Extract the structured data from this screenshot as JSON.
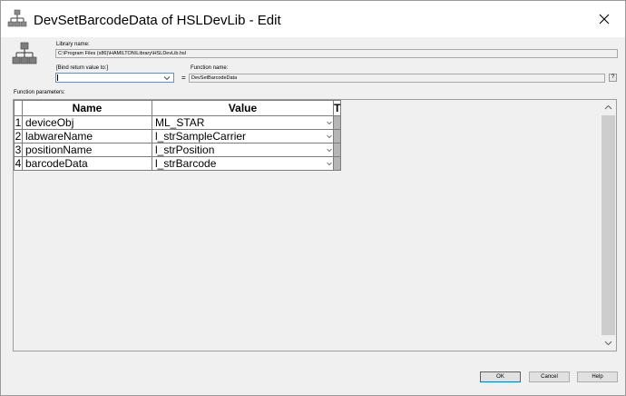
{
  "window": {
    "title": "DevSetBarcodeData of HSLDevLib - Edit"
  },
  "library": {
    "label": "Library name:",
    "value": "C:\\Program Files (x86)\\HAMILTON\\Library\\HSLDevLib.hsl"
  },
  "bind": {
    "label": "[Bind return value to:]",
    "value": ""
  },
  "equals": "=",
  "function": {
    "label": "Function name:",
    "value": "DevSetBarcodeData",
    "help_label": "?"
  },
  "params": {
    "label": "Function parameters:",
    "headers": {
      "name": "Name",
      "value": "Value",
      "type": "T"
    },
    "rows": [
      {
        "index": "1",
        "name": "deviceObj",
        "value": "ML_STAR"
      },
      {
        "index": "2",
        "name": "labwareName",
        "value": "l_strSampleCarrier"
      },
      {
        "index": "3",
        "name": "positionName",
        "value": "l_strPosition"
      },
      {
        "index": "4",
        "name": "barcodeData",
        "value": "l_strBarcode"
      }
    ]
  },
  "buttons": {
    "ok": "OK",
    "cancel": "Cancel",
    "help": "Help"
  },
  "icons": {
    "title": "hierarchy-icon",
    "close": "close-icon"
  }
}
